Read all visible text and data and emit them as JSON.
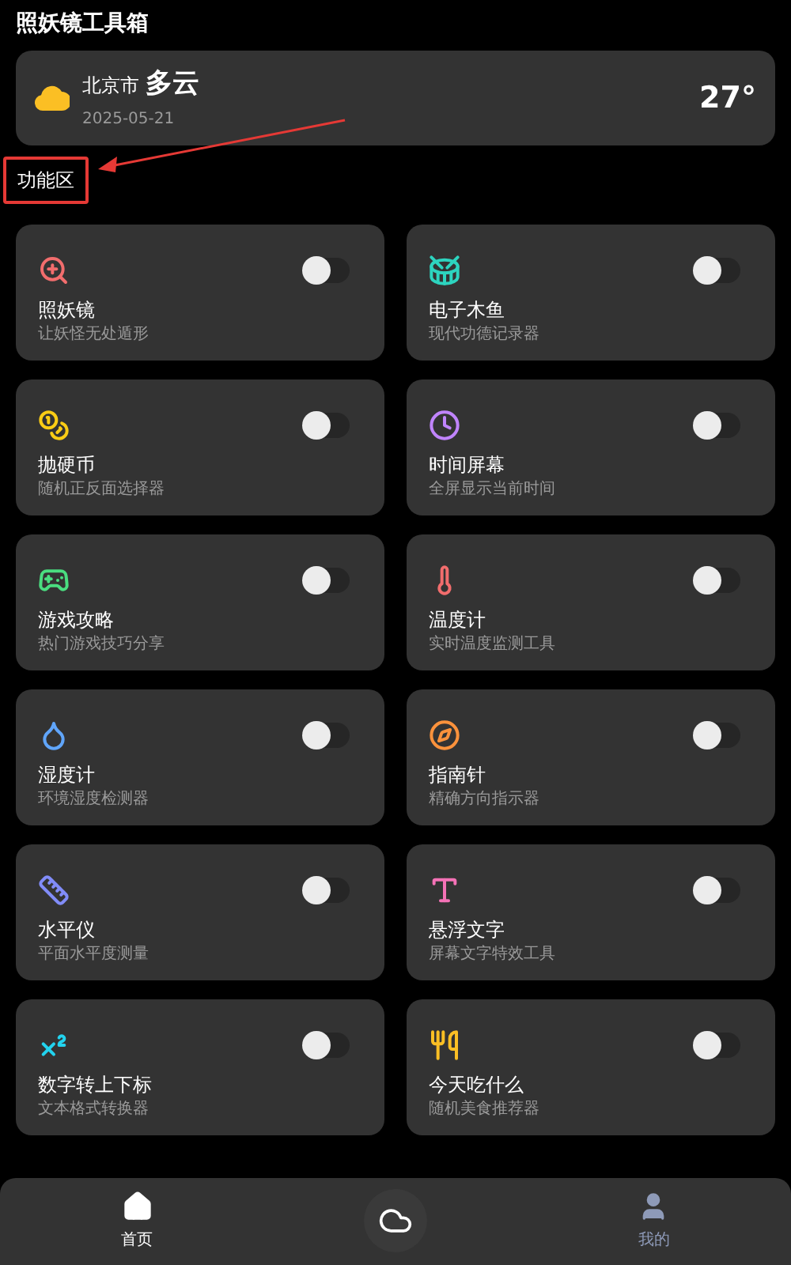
{
  "app_title": "照妖镜工具箱",
  "weather": {
    "city": "北京市",
    "condition": "多云",
    "date": "2025-05-21",
    "temperature": "27°"
  },
  "section_title": "功能区",
  "tools": [
    {
      "name": "照妖镜",
      "description": "让妖怪无处遁形",
      "on": false
    },
    {
      "name": "电子木鱼",
      "description": "现代功德记录器",
      "on": false
    },
    {
      "name": "抛硬币",
      "description": "随机正反面选择器",
      "on": false
    },
    {
      "name": "时间屏幕",
      "description": "全屏显示当前时间",
      "on": false
    },
    {
      "name": "游戏攻略",
      "description": "热门游戏技巧分享",
      "on": false
    },
    {
      "name": "温度计",
      "description": "实时温度监测工具",
      "on": false
    },
    {
      "name": "湿度计",
      "description": "环境湿度检测器",
      "on": false
    },
    {
      "name": "指南针",
      "description": "精确方向指示器",
      "on": false
    },
    {
      "name": "水平仪",
      "description": "平面水平度测量",
      "on": false
    },
    {
      "name": "悬浮文字",
      "description": "屏幕文字特效工具",
      "on": false
    },
    {
      "name": "数字转上下标",
      "description": "文本格式转换器",
      "on": false
    },
    {
      "name": "今天吃什么",
      "description": "随机美食推荐器",
      "on": false
    }
  ],
  "bottom_nav": [
    {
      "kind": "home",
      "label": "首页",
      "selected": true
    },
    {
      "kind": "weather",
      "selected": false
    },
    {
      "kind": "profile",
      "label": "我的",
      "selected": false
    }
  ]
}
